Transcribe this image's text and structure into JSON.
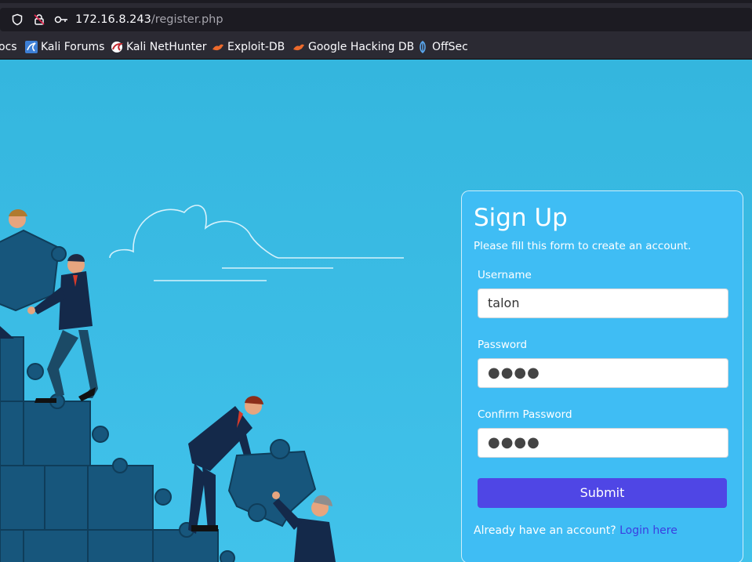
{
  "browser": {
    "url_host": "172.16.8.243",
    "url_path": "/register.php",
    "bookmarks": [
      {
        "label": "ocs",
        "icon": "kali-docs-icon"
      },
      {
        "label": "Kali Forums",
        "icon": "kali-forums-icon"
      },
      {
        "label": "Kali NetHunter",
        "icon": "kali-nethunter-icon"
      },
      {
        "label": "Exploit-DB",
        "icon": "exploit-db-icon"
      },
      {
        "label": "Google Hacking DB",
        "icon": "ghdb-icon"
      },
      {
        "label": "OffSec",
        "icon": "offsec-icon"
      }
    ]
  },
  "form": {
    "title": "Sign Up",
    "subtitle": "Please fill this form to create an account.",
    "username_label": "Username",
    "username_value": "talon",
    "password_label": "Password",
    "password_value": "●●●●",
    "confirm_label": "Confirm Password",
    "confirm_value": "●●●●",
    "submit_label": "Submit",
    "login_prompt": "Already have an account?",
    "login_link": "Login here"
  },
  "colors": {
    "page_bg": "#3cbde6",
    "card_bg": "#3fbdf4",
    "submit_bg": "#4f46e5",
    "link": "#3b3ee0"
  }
}
